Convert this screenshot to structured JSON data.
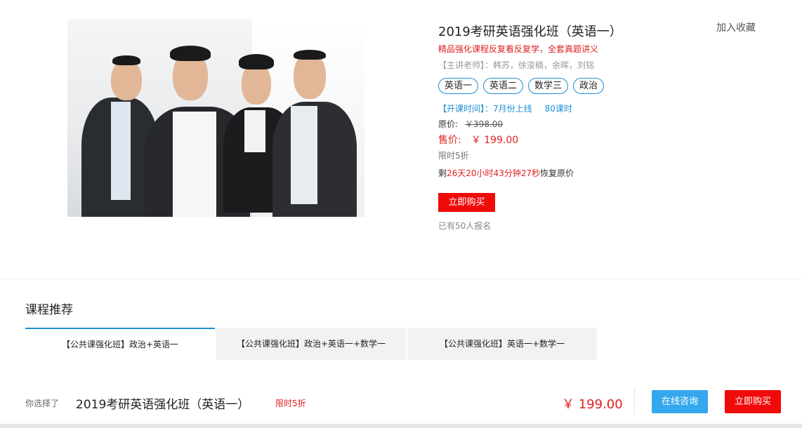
{
  "course": {
    "title": "2019考研英语强化班（英语一）",
    "favorite_label": "加入收藏",
    "slogan": "精品强化课程反复看反复学，全套真题讲义",
    "teachers": "【主讲老师】：韩苏，徐浚楠，余晖，刘铭",
    "tags": [
      "英语一",
      "英语二",
      "数学三",
      "政治"
    ],
    "schedule": "【开课时间】：7月份上线",
    "hours": "80课时",
    "original_price_label": "原价:",
    "original_price": "￥398.00",
    "sale_price_label": "售价:",
    "sale_price": "￥ 199.00",
    "limit_text": "限时5折",
    "countdown": {
      "prefix": "剩",
      "time": "26天20小时43分钟27秒",
      "suffix": "恢复原价"
    },
    "buy_button": "立即购买",
    "enrolled": "已有50人报名"
  },
  "recommend": {
    "title": "课程推荐",
    "tabs": [
      {
        "label": "【公共课强化班】政治+英语一",
        "active": true
      },
      {
        "label": "【公共课强化班】政治+英语一+数学一",
        "active": false
      },
      {
        "label": "【公共课强化班】英语一+数学一",
        "active": false
      }
    ]
  },
  "footer": {
    "chosen_label": "你选择了",
    "chosen_title": "2019考研英语强化班（英语一）",
    "chosen_limit": "限时5折",
    "price": "￥ 199.00",
    "consult_button": "在线咨询",
    "buy_button": "立即购买"
  },
  "colors": {
    "accent_red": "#f00b0b",
    "accent_blue": "#1e8fd6",
    "consult_blue": "#35a7ee"
  }
}
